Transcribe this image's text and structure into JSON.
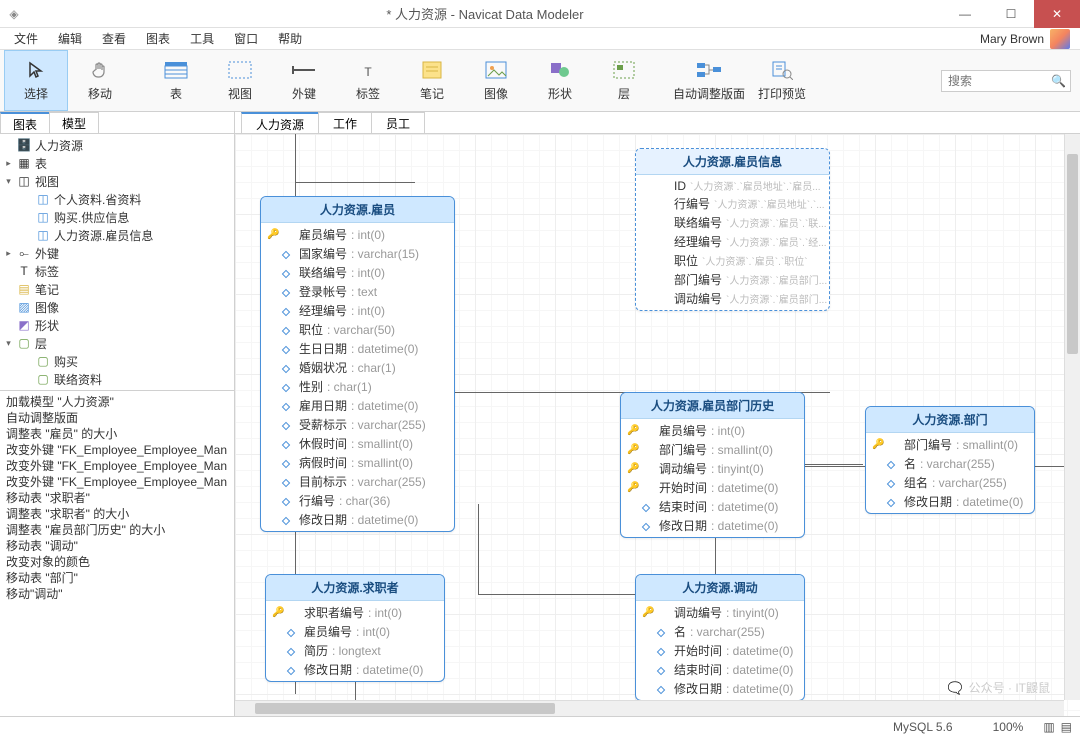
{
  "window": {
    "title": "* 人力资源 - Navicat Data Modeler",
    "user": "Mary Brown"
  },
  "menus": [
    "文件",
    "编辑",
    "查看",
    "图表",
    "工具",
    "窗口",
    "帮助"
  ],
  "toolbar": [
    {
      "id": "select",
      "label": "选择"
    },
    {
      "id": "move",
      "label": "移动"
    },
    {
      "id": "table",
      "label": "表"
    },
    {
      "id": "view",
      "label": "视图"
    },
    {
      "id": "fk",
      "label": "外键"
    },
    {
      "id": "label",
      "label": "标签"
    },
    {
      "id": "note",
      "label": "笔记"
    },
    {
      "id": "image",
      "label": "图像"
    },
    {
      "id": "shape",
      "label": "形状"
    },
    {
      "id": "layer",
      "label": "层"
    },
    {
      "id": "autolayout",
      "label": "自动调整版面"
    },
    {
      "id": "printpreview",
      "label": "打印预览"
    }
  ],
  "search": {
    "placeholder": "搜索"
  },
  "leftTabs": [
    "图表",
    "模型"
  ],
  "tree": {
    "root": "人力资源",
    "table": "表",
    "view": "视图",
    "views": [
      "个人资料.省资料",
      "购买.供应信息",
      "人力资源.雇员信息"
    ],
    "fk": "外键",
    "label": "标签",
    "note": "笔记",
    "image": "图像",
    "shape": "形状",
    "layer": "层",
    "layers": [
      "购买",
      "联络资料"
    ]
  },
  "log": [
    "加载模型 \"人力资源\"",
    "自动调整版面",
    "调整表 \"雇员\" 的大小",
    "改变外键 \"FK_Employee_Employee_Man",
    "改变外键 \"FK_Employee_Employee_Man",
    "改变外键 \"FK_Employee_Employee_Man",
    "移动表 \"求职者\"",
    "调整表 \"求职者\" 的大小",
    "调整表 \"雇员部门历史\" 的大小",
    "移动表 \"调动\"",
    "改变对象的颜色",
    "移动表 \"部门\"",
    "移动\"调动\""
  ],
  "canvasTabs": [
    "人力资源",
    "工作",
    "员工"
  ],
  "entities": {
    "emp": {
      "title": "人力资源.雇员",
      "fields": [
        {
          "k": 1,
          "n": "雇员编号",
          "t": ": int(0)"
        },
        {
          "n": "国家编号",
          "t": ": varchar(15)"
        },
        {
          "n": "联络编号",
          "t": ": int(0)"
        },
        {
          "n": "登录帐号",
          "t": ": text"
        },
        {
          "n": "经理编号",
          "t": ": int(0)"
        },
        {
          "n": "职位",
          "t": ": varchar(50)"
        },
        {
          "n": "生日日期",
          "t": ": datetime(0)"
        },
        {
          "n": "婚姻状况",
          "t": ": char(1)"
        },
        {
          "n": "性别",
          "t": ": char(1)"
        },
        {
          "n": "雇用日期",
          "t": ": datetime(0)"
        },
        {
          "n": "受薪标示",
          "t": ": varchar(255)"
        },
        {
          "n": "休假时间",
          "t": ": smallint(0)"
        },
        {
          "n": "病假时间",
          "t": ": smallint(0)"
        },
        {
          "n": "目前标示",
          "t": ": varchar(255)"
        },
        {
          "n": "行编号",
          "t": ": char(36)"
        },
        {
          "n": "修改日期",
          "t": ": datetime(0)"
        }
      ]
    },
    "info": {
      "title": "人力资源.雇员信息",
      "fields": [
        {
          "n": "ID",
          "r": "`人力资源`.`雇员地址`.`雇员..."
        },
        {
          "n": "行编号",
          "r": "`人力资源`.`雇员地址`.`..."
        },
        {
          "n": "联络编号",
          "r": "`人力资源`.`雇员`.`联..."
        },
        {
          "n": "经理编号",
          "r": "`人力资源`.`雇员`.`经..."
        },
        {
          "n": "职位",
          "r": "`人力资源`.`雇员`.`职位`"
        },
        {
          "n": "部门编号",
          "r": "`人力资源`.`雇员部门..."
        },
        {
          "n": "调动编号",
          "r": "`人力资源`.`雇员部门..."
        }
      ]
    },
    "hist": {
      "title": "人力资源.雇员部门历史",
      "fields": [
        {
          "k": 1,
          "n": "雇员编号",
          "t": ": int(0)"
        },
        {
          "k": 1,
          "n": "部门编号",
          "t": ": smallint(0)"
        },
        {
          "k": 1,
          "n": "调动编号",
          "t": ": tinyint(0)"
        },
        {
          "k": 1,
          "n": "开始时间",
          "t": ": datetime(0)"
        },
        {
          "n": "结束时间",
          "t": ": datetime(0)"
        },
        {
          "n": "修改日期",
          "t": ": datetime(0)"
        }
      ]
    },
    "dept": {
      "title": "人力资源.部门",
      "fields": [
        {
          "k": 1,
          "n": "部门编号",
          "t": ": smallint(0)"
        },
        {
          "n": "名",
          "t": ": varchar(255)"
        },
        {
          "n": "组名",
          "t": ": varchar(255)"
        },
        {
          "n": "修改日期",
          "t": ": datetime(0)"
        }
      ]
    },
    "cand": {
      "title": "人力资源.求职者",
      "fields": [
        {
          "k": 1,
          "n": "求职者编号",
          "t": ": int(0)"
        },
        {
          "n": "雇员编号",
          "t": ": int(0)"
        },
        {
          "n": "简历",
          "t": ": longtext"
        },
        {
          "n": "修改日期",
          "t": ": datetime(0)"
        }
      ]
    },
    "shift": {
      "title": "人力资源.调动",
      "fields": [
        {
          "k": 1,
          "n": "调动编号",
          "t": ": tinyint(0)"
        },
        {
          "n": "名",
          "t": ": varchar(255)"
        },
        {
          "n": "开始时间",
          "t": ": datetime(0)"
        },
        {
          "n": "结束时间",
          "t": ": datetime(0)"
        },
        {
          "n": "修改日期",
          "t": ": datetime(0)"
        }
      ]
    }
  },
  "status": {
    "db": "MySQL 5.6",
    "zoom": "100%"
  },
  "watermark": "公众号 · IT鼹鼠"
}
